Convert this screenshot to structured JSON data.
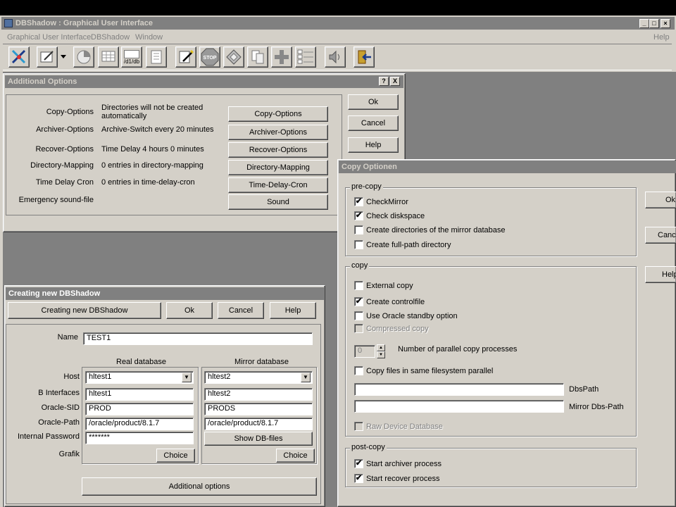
{
  "app": {
    "title": "DBShadow : Graphical User Interface",
    "menu": [
      "Graphical User Interface",
      "DBShadow",
      "Window"
    ],
    "help": "Help",
    "window_buttons": [
      "_",
      "□",
      "X"
    ]
  },
  "toolbar": {
    "icons": [
      "dbshadow-icon",
      "edit-icon",
      "pie-chart-icon",
      "grid-icon",
      "d1db-icon",
      "list-icon",
      "pencil-icon",
      "stop-icon",
      "diamond-icon",
      "files-icon",
      "plus-icon",
      "checklist-icon",
      "speaker-icon",
      "exit-icon"
    ],
    "d1db_label": "/d1/db",
    "stop_label": "STOP"
  },
  "additional_options": {
    "title": "Additional Options",
    "title_buttons": [
      "?",
      "X"
    ],
    "rows": [
      {
        "label": "Copy-Options",
        "value": "Directories will not be created automatically",
        "button": "Copy-Options"
      },
      {
        "label": "Archiver-Options",
        "value": "Archive-Switch every 20 minutes",
        "button": "Archiver-Options"
      },
      {
        "label": "Recover-Options",
        "value": "Time Delay 4 hours  0 minutes",
        "button": "Recover-Options"
      },
      {
        "label": "Directory-Mapping",
        "value": "0 entries in directory-mapping",
        "button": "Directory-Mapping"
      },
      {
        "label": "Time Delay Cron",
        "value": "0 entries in time-delay-cron",
        "button": "Time-Delay-Cron"
      },
      {
        "label": "Emergency sound-file",
        "value": "",
        "button": "Sound"
      }
    ],
    "ok": "Ok",
    "cancel": "Cancel",
    "help": "Help"
  },
  "creating": {
    "title": "Creating new DBShadow",
    "header_button": "Creating new DBShadow",
    "ok": "Ok",
    "cancel": "Cancel",
    "help": "Help",
    "name_label": "Name",
    "name_value": "TEST1",
    "real_db": "Real database",
    "mirror_db": "Mirror database",
    "labels": [
      "Host",
      "B Interfaces",
      "Oracle-SID",
      "Oracle-Path",
      "Internal Password",
      "Grafik"
    ],
    "real": {
      "host": "hltest1",
      "interfaces": "hltest1",
      "sid": "PROD",
      "path": "/oracle/product/8.1.7",
      "password": "*******"
    },
    "mirror": {
      "host": "hltest2",
      "interfaces": "hltest2",
      "sid": "PRODS",
      "path": "/oracle/product/8.1.7"
    },
    "show_db_files": "Show DB-files",
    "choice": "Choice",
    "additional": "Additional options"
  },
  "copy": {
    "title": "Copy Optionen",
    "precopy_title": "pre-copy",
    "precopy": [
      {
        "label": "CheckMirror",
        "checked": "✔"
      },
      {
        "label": "Check diskspace",
        "checked": "✔"
      },
      {
        "label": "Create directories of the mirror database",
        "checked": ""
      },
      {
        "label": "Create full-path directory",
        "checked": ""
      }
    ],
    "copy_title": "copy",
    "copy_items": [
      {
        "label": "External copy",
        "checked": ""
      },
      {
        "label": "Create controlfile",
        "checked": "✔"
      },
      {
        "label": "Use Oracle standby option",
        "checked": ""
      },
      {
        "label": "Compressed copy",
        "checked": ""
      }
    ],
    "parallel_value": "0",
    "parallel_label": "Number of parallel copy processes",
    "same_fs": "Copy files in same filesystem parallel",
    "dbs_path": "DbsPath",
    "mirror_dbs_path": "Mirror Dbs-Path",
    "raw_device": "Raw Device Database",
    "postcopy_title": "post-copy",
    "postcopy": [
      {
        "label": "Start archiver process",
        "checked": "✔"
      },
      {
        "label": "Start recover process",
        "checked": "✔"
      }
    ],
    "ok": "Ok",
    "cancel": "Cance",
    "help": "Help"
  }
}
